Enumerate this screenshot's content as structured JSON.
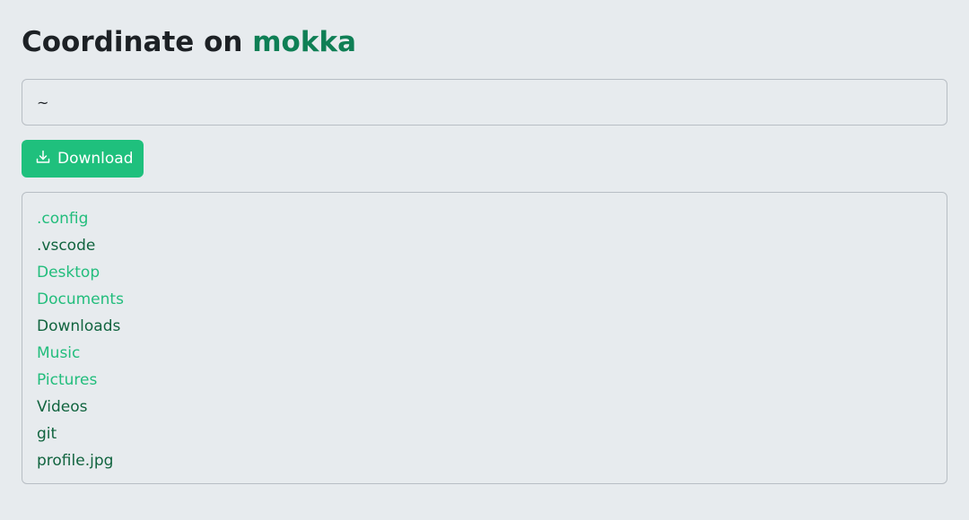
{
  "header": {
    "title_prefix": "Coordinate on ",
    "host": "mokka"
  },
  "path_input": {
    "value": "~"
  },
  "download_button": {
    "label": "Download",
    "icon": "download-icon"
  },
  "files": [
    {
      "name": ".config",
      "kind": "dir"
    },
    {
      "name": ".vscode",
      "kind": "file"
    },
    {
      "name": "Desktop",
      "kind": "dir"
    },
    {
      "name": "Documents",
      "kind": "dir"
    },
    {
      "name": "Downloads",
      "kind": "file"
    },
    {
      "name": "Music",
      "kind": "dir"
    },
    {
      "name": "Pictures",
      "kind": "dir"
    },
    {
      "name": "Videos",
      "kind": "file"
    },
    {
      "name": "git",
      "kind": "file"
    },
    {
      "name": "profile.jpg",
      "kind": "file"
    }
  ],
  "colors": {
    "background": "#e7ebee",
    "accent": "#1fc07d",
    "host": "#0f7f55",
    "directory_text": "#22bd7c",
    "file_text": "#11643f"
  }
}
